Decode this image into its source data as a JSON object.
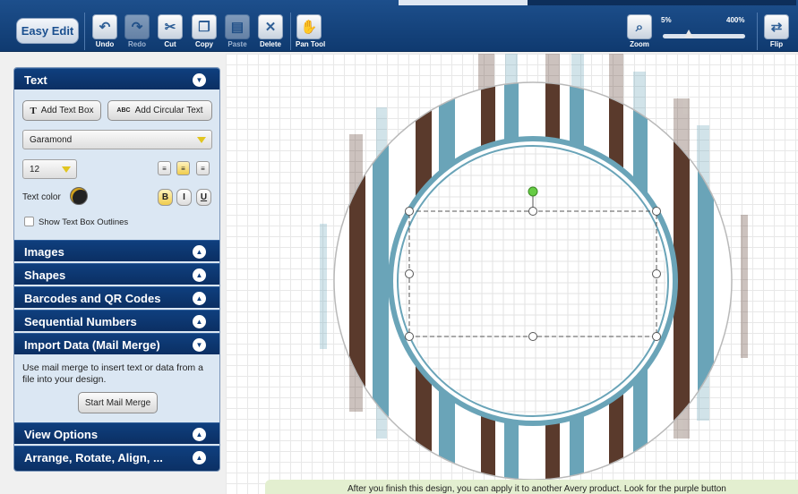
{
  "toolbar": {
    "easy_edit": "Easy Edit",
    "tools": [
      {
        "label": "Undo",
        "icon": "undo-icon",
        "enabled": true
      },
      {
        "label": "Redo",
        "icon": "redo-icon",
        "enabled": false
      },
      {
        "label": "Cut",
        "icon": "scissors-icon",
        "enabled": true
      },
      {
        "label": "Copy",
        "icon": "copy-icon",
        "enabled": true
      },
      {
        "label": "Paste",
        "icon": "paste-icon",
        "enabled": false
      },
      {
        "label": "Delete",
        "icon": "delete-icon",
        "enabled": true
      },
      {
        "label": "Pan Tool",
        "icon": "hand-icon",
        "enabled": true
      }
    ],
    "zoom_label": "Zoom",
    "zoom_min": "5%",
    "zoom_max": "400%",
    "zoom_level_fraction": 0.32,
    "flip_label": "Flip"
  },
  "panel": {
    "text_section": {
      "title": "Text",
      "add_text_box": "Add Text Box",
      "add_circular_text": "Add Circular Text",
      "circular_icon_text": "ABC",
      "font": "Garamond",
      "font_size": "12",
      "align_active": "center",
      "text_color_label": "Text color",
      "bold": "B",
      "italic": "I",
      "underline": "U",
      "bold_active": true,
      "show_outlines_label": "Show Text Box Outlines",
      "show_outlines_checked": false
    },
    "sections": {
      "images": "Images",
      "shapes": "Shapes",
      "barcodes": "Barcodes and QR Codes",
      "sequential": "Sequential Numbers",
      "import": "Import Data (Mail Merge)",
      "view": "View Options",
      "arrange": "Arrange, Rotate, Align, ..."
    },
    "mail_merge": {
      "description": "Use mail merge to insert text or data from a file into your design.",
      "button": "Start Mail Merge"
    }
  },
  "colors": {
    "brown_stripe": "#5a3a2c",
    "teal_stripe": "#6aa4b8",
    "toolbar": "#1d4f8c"
  },
  "banner": "After you finish this design, you can apply it to another Avery product. Look for the purple button"
}
